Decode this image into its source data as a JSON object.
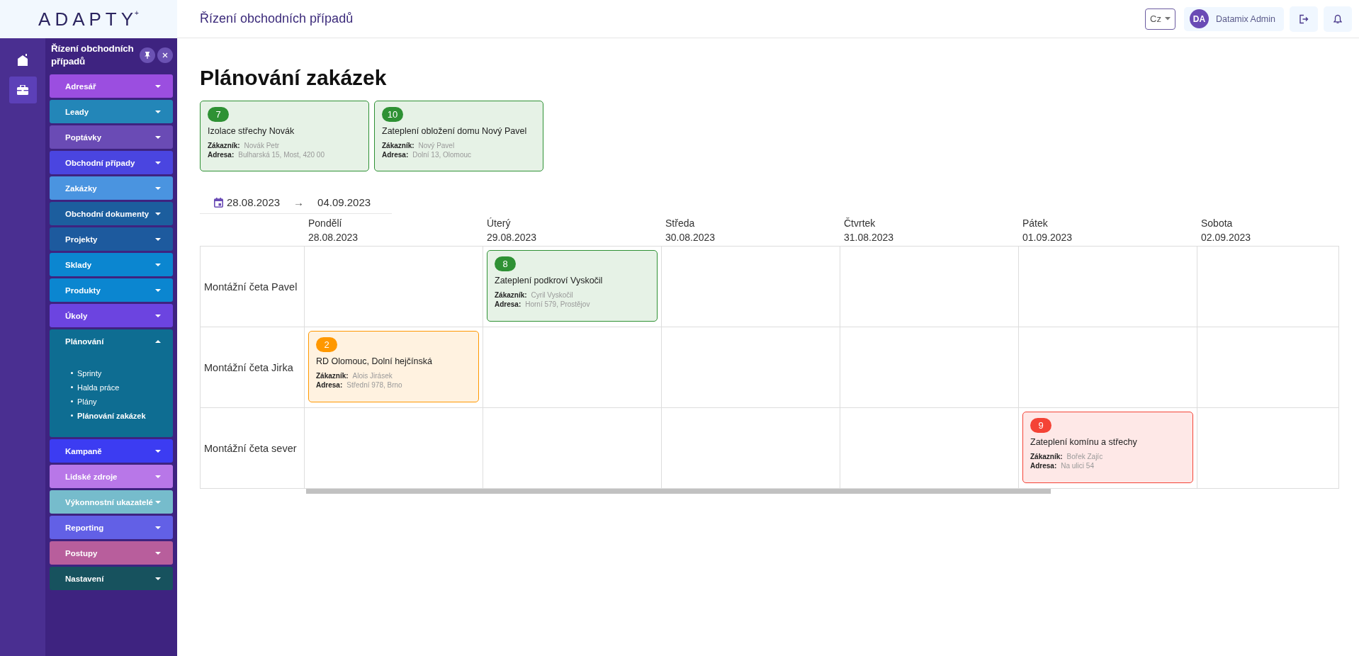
{
  "logo": {
    "text": "ADAPTY",
    "mark": "+"
  },
  "rail": [
    {
      "kind": "home",
      "selected": false
    },
    {
      "kind": "briefcase",
      "selected": true
    }
  ],
  "sidebar": {
    "title": "Řízení obchodních případů",
    "items": [
      {
        "label": "Adresář",
        "color": "#9b4ee0",
        "expanded": false
      },
      {
        "label": "Leady",
        "color": "#2386b8",
        "expanded": false
      },
      {
        "label": "Poptávky",
        "color": "#6a4bb5",
        "expanded": false
      },
      {
        "label": "Obchodní případy",
        "color": "#4a45e0",
        "expanded": false
      },
      {
        "label": "Zakázky",
        "color": "#4a94e0",
        "expanded": false
      },
      {
        "label": "Obchodní dokumenty",
        "color": "#1c5e9e",
        "expanded": false
      },
      {
        "label": "Projekty",
        "color": "#1d5a9e",
        "expanded": false
      },
      {
        "label": "Sklady",
        "color": "#0b86d0",
        "expanded": false
      },
      {
        "label": "Produkty",
        "color": "#0b86d0",
        "expanded": false
      },
      {
        "label": "Úkoly",
        "color": "#6c44e0",
        "expanded": false
      },
      {
        "label": "Plánování",
        "color": "#0e6d92",
        "expanded": true,
        "children": [
          {
            "label": "Sprinty",
            "selected": false
          },
          {
            "label": "Halda práce",
            "selected": false
          },
          {
            "label": "Plány",
            "selected": false
          },
          {
            "label": "Plánování zakázek",
            "selected": true
          }
        ]
      },
      {
        "label": "Kampaně",
        "color": "#3c3cf2",
        "expanded": false
      },
      {
        "label": "Lidské zdroje",
        "color": "#b877e8",
        "expanded": false
      },
      {
        "label": "Výkonnostní ukazatelé",
        "color": "#76bccc",
        "expanded": false
      },
      {
        "label": "Reporting",
        "color": "#6260e6",
        "expanded": false
      },
      {
        "label": "Postupy",
        "color": "#b85e9c",
        "expanded": false
      },
      {
        "label": "Nastavení",
        "color": "#17525e",
        "expanded": false
      }
    ]
  },
  "topbar": {
    "title": "Řízení obchodních případů",
    "language": "Cz",
    "user": {
      "initials": "DA",
      "name": "Datamix Admin"
    }
  },
  "page_title": "Plánování zakázek",
  "unassigned": [
    {
      "number": "7",
      "title": "Izolace střechy Novák",
      "customer_label": "Zákazník:",
      "customer": "Novák Petr",
      "address_label": "Adresa:",
      "address": "Bulharská 15, Most, 420 00",
      "color": "#2e9134"
    },
    {
      "number": "10",
      "title": "Zateplení obložení domu Nový Pavel",
      "customer_label": "Zákazník:",
      "customer": "Nový Pavel",
      "address_label": "Adresa:",
      "address": "Dolní 13, Olomouc",
      "color": "#2e9134"
    }
  ],
  "date_range": {
    "from": "28.08.2023",
    "arrow": "→",
    "to": "04.09.2023"
  },
  "days": [
    {
      "name": "Pondělí",
      "date": "28.08.2023"
    },
    {
      "name": "Úterý",
      "date": "29.08.2023"
    },
    {
      "name": "Středa",
      "date": "30.08.2023"
    },
    {
      "name": "Čtvrtek",
      "date": "31.08.2023"
    },
    {
      "name": "Pátek",
      "date": "01.09.2023"
    },
    {
      "name": "Sobota",
      "date": "02.09.2023"
    }
  ],
  "teams": [
    {
      "name": "Montážní četa Pavel",
      "cells": [
        null,
        {
          "number": "8",
          "title": "Zateplení podkroví Vyskočil",
          "customer_label": "Zákazník:",
          "customer": "Cyril Vyskočil",
          "address_label": "Adresa:",
          "address": "Horní 579, Prostějov",
          "color": "#2e9134"
        },
        null,
        null,
        null,
        null
      ]
    },
    {
      "name": "Montážní četa Jirka",
      "cells": [
        {
          "number": "2",
          "title": "RD Olomouc, Dolní hejčínská",
          "customer_label": "Zákazník:",
          "customer": "Alois Jirásek",
          "address_label": "Adresa:",
          "address": "Střední 978, Brno",
          "color": "#ff9800"
        },
        null,
        null,
        null,
        null,
        null
      ]
    },
    {
      "name": "Montážní četa sever",
      "cells": [
        null,
        null,
        null,
        null,
        {
          "number": "9",
          "title": "Zateplení komínu a střechy",
          "customer_label": "Zákazník:",
          "customer": "Bořek Zajíc",
          "address_label": "Adresa:",
          "address": "Na ulici 54",
          "color": "#f44336"
        },
        null
      ]
    }
  ]
}
